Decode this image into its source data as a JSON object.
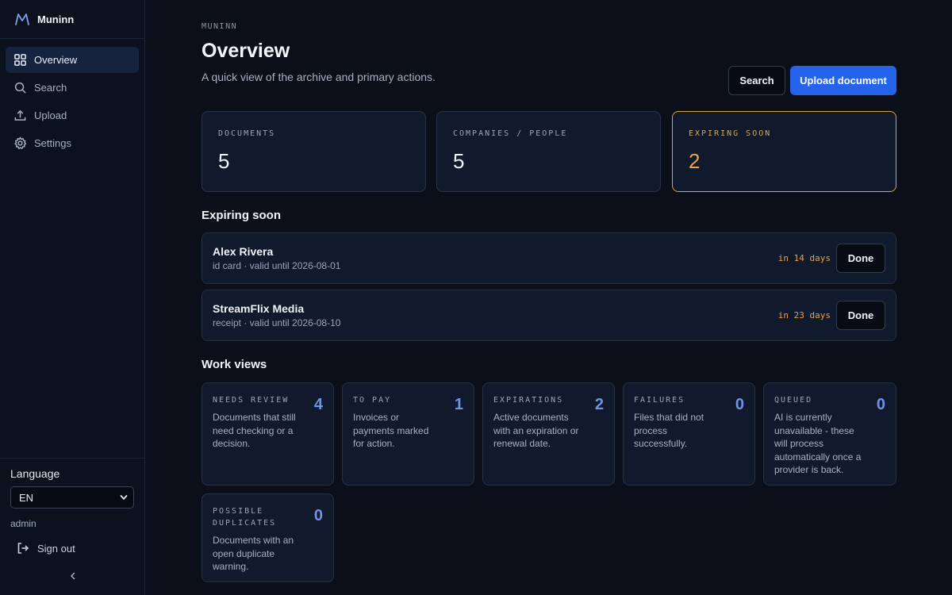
{
  "app": {
    "name": "Muninn"
  },
  "sidebar": {
    "items": [
      {
        "label": "Overview",
        "icon": "grid-icon",
        "active": true
      },
      {
        "label": "Search",
        "icon": "search-icon",
        "active": false
      },
      {
        "label": "Upload",
        "icon": "upload-icon",
        "active": false
      },
      {
        "label": "Settings",
        "icon": "gear-icon",
        "active": false
      }
    ],
    "language_label": "Language",
    "language_value": "EN",
    "user": "admin",
    "signout_label": "Sign out"
  },
  "header": {
    "eyebrow": "MUNINN",
    "title": "Overview",
    "subtitle": "A quick view of the archive and primary actions.",
    "search_label": "Search",
    "upload_label": "Upload document"
  },
  "stats": [
    {
      "label": "DOCUMENTS",
      "value": "5"
    },
    {
      "label": "COMPANIES / PEOPLE",
      "value": "5"
    },
    {
      "label": "EXPIRING SOON",
      "value": "2"
    }
  ],
  "expiring": {
    "title": "Expiring soon",
    "items": [
      {
        "name": "Alex Rivera",
        "meta": "id card · valid until 2026-08-01",
        "days": "in 14 days",
        "action": "Done"
      },
      {
        "name": "StreamFlix Media",
        "meta": "receipt · valid until 2026-08-10",
        "days": "in 23 days",
        "action": "Done"
      }
    ]
  },
  "work_views": {
    "title": "Work views",
    "items": [
      {
        "label": "NEEDS REVIEW",
        "count": "4",
        "desc": "Documents that still need checking or a decision."
      },
      {
        "label": "TO PAY",
        "count": "1",
        "desc": "Invoices or payments marked for action."
      },
      {
        "label": "EXPIRATIONS",
        "count": "2",
        "desc": "Active documents with an expiration or renewal date."
      },
      {
        "label": "FAILURES",
        "count": "0",
        "desc": "Files that did not process successfully."
      },
      {
        "label": "QUEUED",
        "count": "0",
        "desc": "AI is currently unavailable - these will process automatically once a provider is back."
      },
      {
        "label": "POSSIBLE DUPLICATES",
        "count": "0",
        "desc": "Documents with an open duplicate warning."
      }
    ]
  },
  "colors": {
    "accent": "#2563eb",
    "warning": "#dca551",
    "count": "#6f93e6",
    "background": "#0a0f1a"
  }
}
